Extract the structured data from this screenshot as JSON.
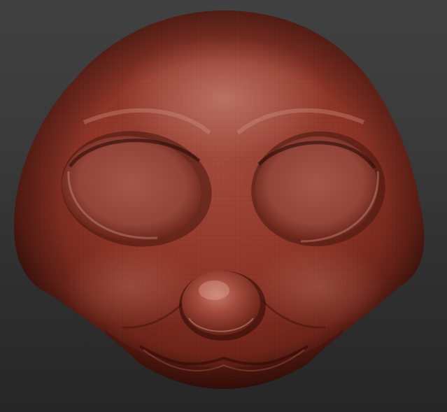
{
  "viewport": {
    "background_top": "#414141",
    "background_bottom": "#262626"
  },
  "model": {
    "material_color": "#9a3a2c",
    "highlight_color": "#c98a7c",
    "shadow_color": "#3a100a",
    "wireframe_visible": true,
    "features": [
      "head",
      "left-eye-socket",
      "right-eye-socket",
      "nose",
      "mouth-line",
      "cheeks",
      "brow"
    ]
  }
}
